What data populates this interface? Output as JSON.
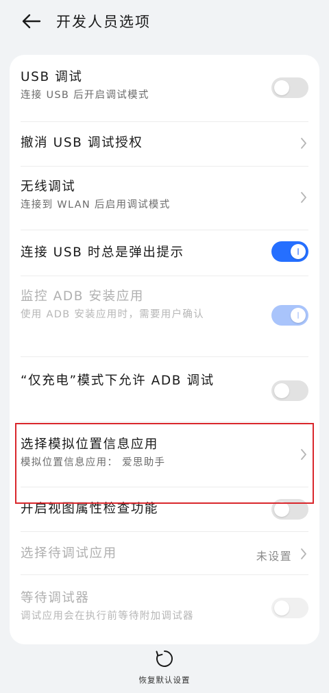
{
  "header": {
    "title": "开发人员选项",
    "back_icon": "arrow-left-icon"
  },
  "items": [
    {
      "title": "USB 调试",
      "subtitle": "连接 USB 后开启调试模式",
      "control": "toggle",
      "state": "off",
      "enabled": true
    },
    {
      "title": "撤消 USB 调试授权",
      "control": "chevron",
      "enabled": true
    },
    {
      "title": "无线调试",
      "subtitle": "连接到 WLAN 后启用调试模式",
      "control": "chevron",
      "enabled": true
    },
    {
      "title": "连接 USB 时总是弹出提示",
      "control": "toggle",
      "state": "on",
      "enabled": true
    },
    {
      "title": "监控 ADB 安装应用",
      "subtitle": "使用 ADB 安装应用时，需要用户确认",
      "control": "toggle",
      "state": "on",
      "enabled": false
    },
    {
      "title": "“仅充电”模式下允许 ADB 调试",
      "control": "toggle",
      "state": "off",
      "enabled": true
    },
    {
      "title": "选择模拟位置信息应用",
      "subtitle": "模拟位置信息应用： 爱思助手",
      "control": "chevron",
      "enabled": true
    },
    {
      "title": "开启视图属性检查功能",
      "control": "toggle",
      "state": "off",
      "enabled": true
    },
    {
      "title": "选择待调试应用",
      "value": "未设置",
      "control": "chevron",
      "enabled": false
    },
    {
      "title": "等待调试器",
      "subtitle": "调试应用会在执行前等待附加调试器",
      "control": "toggle",
      "state": "off",
      "enabled": false
    }
  ],
  "bottom": {
    "label": "恢复默认设置",
    "icon": "reset-icon"
  },
  "colors": {
    "accent": "#256fff",
    "highlight": "#d9262b",
    "background": "#f1f3f5"
  }
}
